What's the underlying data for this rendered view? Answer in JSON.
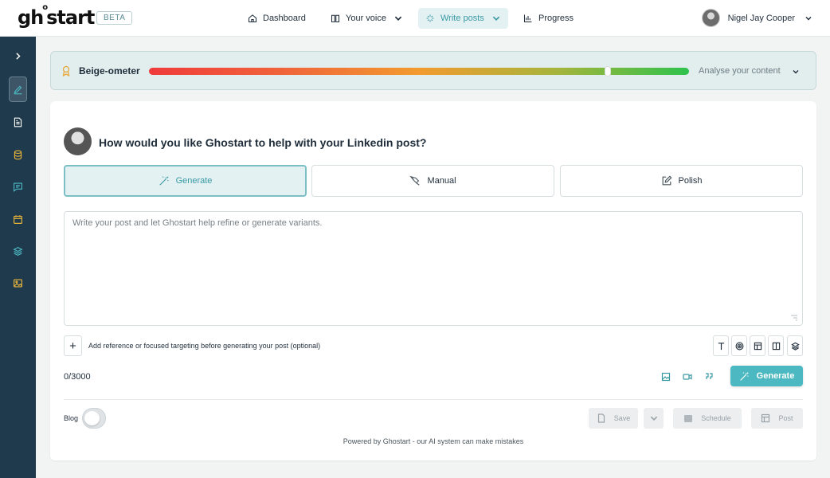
{
  "header": {
    "logo": {
      "left": "gh",
      "sup": "o",
      "right": "start"
    },
    "beta": "BETA",
    "nav": [
      {
        "label": "Dashboard",
        "icon": "home-icon"
      },
      {
        "label": "Your voice",
        "icon": "book-icon"
      },
      {
        "label": "Write posts",
        "icon": "sparkle-icon"
      },
      {
        "label": "Progress",
        "icon": "bar-chart-icon"
      }
    ],
    "user_name": "Nigel Jay Cooper"
  },
  "meter": {
    "title": "Beige-ometer",
    "level": 0.85,
    "analyse_label": "Analyse your content"
  },
  "composer": {
    "question": "How would you like Ghostart to help with your Linkedin post?",
    "modes": [
      {
        "label": "Generate",
        "active": true
      },
      {
        "label": "Manual",
        "active": false
      },
      {
        "label": "Polish",
        "active": false
      }
    ],
    "placeholder": "Write your post and let Ghostart help refine or generate variants.",
    "reference_hint": "Add reference or focused targeting before generating your post (optional)",
    "counter": "0/3000",
    "generate_label": "Generate",
    "blog_label": "Blog",
    "save_label": "Save",
    "schedule_label": "Schedule",
    "post_label": "Post",
    "powered_by": "Powered by Ghostart - our AI system can make mistakes"
  },
  "colors": {
    "sidebar": "#1f3a4d",
    "accent": "#4cb8c2",
    "sidebar_icon": "#e8b53a"
  }
}
